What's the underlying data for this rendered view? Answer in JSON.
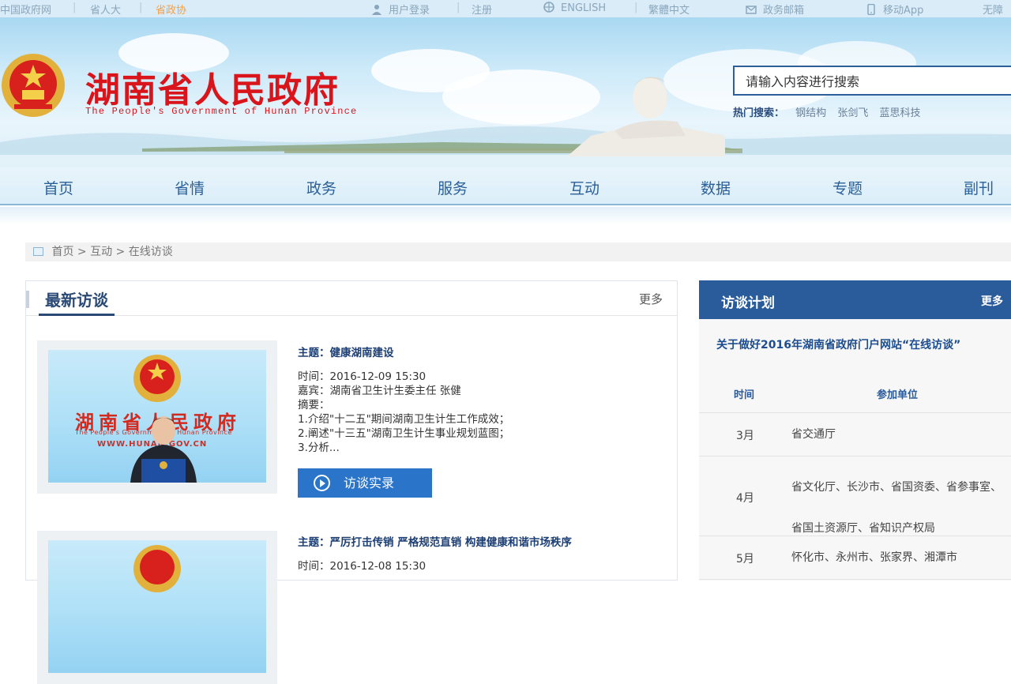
{
  "topbar": {
    "links": [
      "中国政府网",
      "省人大",
      "省政协"
    ],
    "user_login": "用户登录",
    "register": "注册",
    "english": "ENGLISH",
    "traditional": "繁體中文",
    "mailbox": "政务邮箱",
    "mobile_app": "移动App",
    "accessibility": "无障"
  },
  "header": {
    "title": "湖南省人民政府",
    "subtitle": "The People's Government of Hunan Province",
    "search_value": "请输入内容进行搜索",
    "hot_label": "热门搜索：",
    "hot_keywords": [
      "钢结构",
      "张剑飞",
      "蓝思科技"
    ]
  },
  "nav": {
    "items": [
      "首页",
      "省情",
      "政务",
      "服务",
      "互动",
      "数据",
      "专题",
      "副刊"
    ]
  },
  "breadcrumb": {
    "items": [
      "首页",
      "互动",
      "在线访谈"
    ],
    "separator": ">"
  },
  "latest": {
    "title": "最新访谈",
    "more": "更多",
    "photo": {
      "title": "湖南省人民政府",
      "subtitle": "The People's Government of Hunan Province",
      "url": "WWW.HUNAN.GOV.CN"
    },
    "items": [
      {
        "topic": "主题：健康湖南建设",
        "time": "时间：2016-12-09 15:30",
        "guest": "嘉宾：湖南省卫生计生委主任 张健",
        "summary_label": "摘要：",
        "summary_lines": [
          "1.介绍\"十二五\"期间湖南卫生计生工作成效；",
          "2.阐述\"十三五\"湖南卫生计生事业规划蓝图；",
          "3.分析..."
        ],
        "button": "访谈实录"
      },
      {
        "topic": "主题：严厉打击传销 严格规范直销 构建健康和谐市场秩序",
        "time": "时间：2016-12-08 15:30"
      }
    ]
  },
  "plan": {
    "title": "访谈计划",
    "more": "更多",
    "notice": "关于做好2016年湖南省政府门户网站“在线访谈”",
    "col_time": "时间",
    "col_unit": "参加单位",
    "rows": [
      {
        "month": "3月",
        "units": "省交通厅"
      },
      {
        "month": "4月",
        "units": "省文化厅、长沙市、省国资委、省参事室、省国土资源厅、省知识产权局"
      },
      {
        "month": "5月",
        "units": "怀化市、永州市、张家界、湘潭市"
      }
    ]
  },
  "colors": {
    "brand_red": "#d9141b",
    "nav_blue": "#2a5f98",
    "panel_blue": "#2a5b9b",
    "button_blue": "#2a74c9"
  }
}
